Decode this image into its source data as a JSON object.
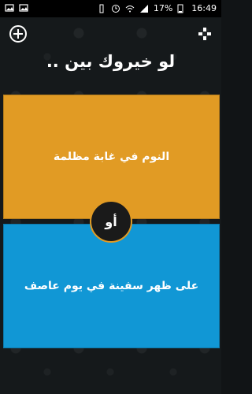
{
  "status": {
    "battery": "17%",
    "time": "16:49"
  },
  "header": {
    "title": "لو خيروك بين .."
  },
  "options": {
    "first": "النوم في غابة مظلمة",
    "second": "على ظهر سفينة في يوم عاصف",
    "or_label": "أو"
  },
  "colors": {
    "first_card": "#e19b24",
    "second_card": "#1197d5",
    "or_border": "#e19b24"
  },
  "icons": {
    "add": "add-circle-icon",
    "game": "gamepad-icon"
  }
}
